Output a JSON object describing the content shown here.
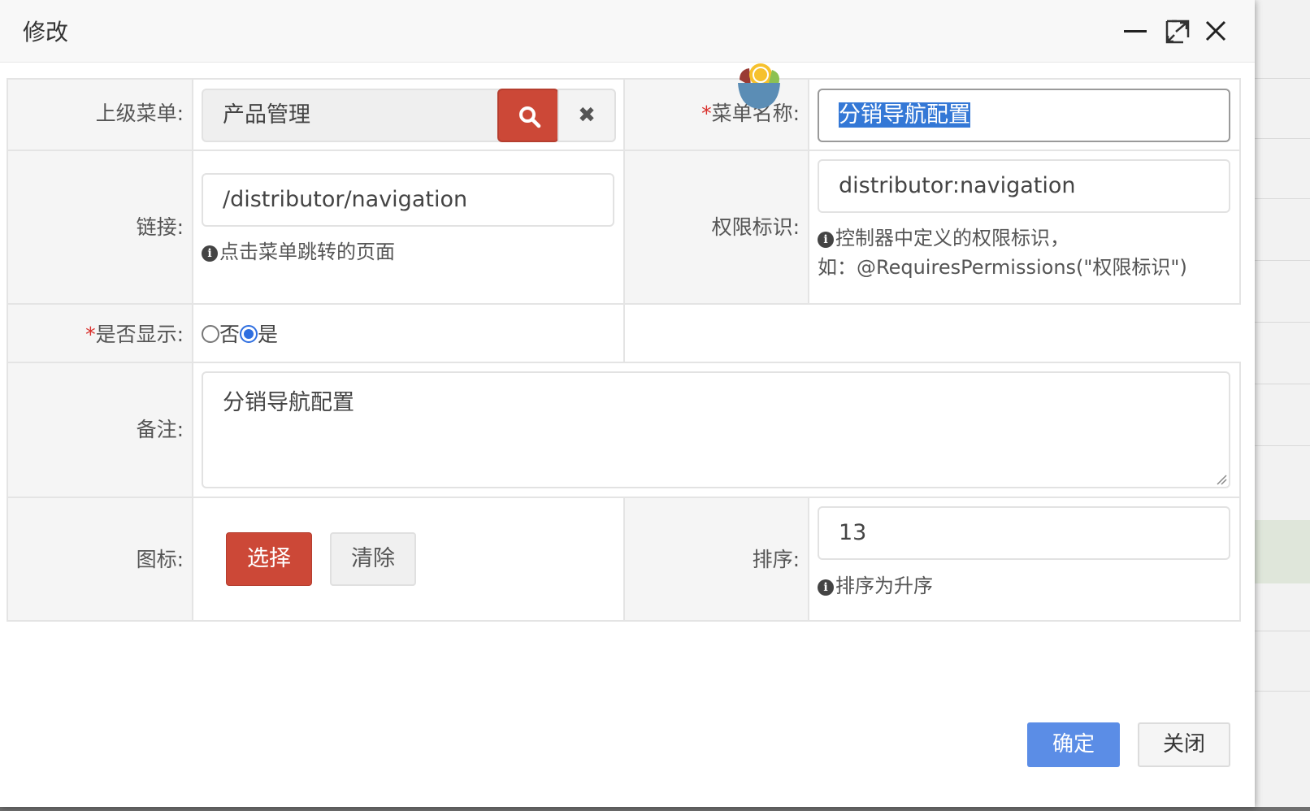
{
  "dialog": {
    "title": "修改",
    "window_controls": [
      "minimize-icon",
      "maximize-icon",
      "close-icon"
    ]
  },
  "form": {
    "parent_menu": {
      "label": "上级菜单:",
      "value": "产品管理",
      "clear_symbol": "✖"
    },
    "menu_name": {
      "required_mark": "*",
      "label": "菜单名称:",
      "value": "分销导航配置"
    },
    "link": {
      "label": "链接:",
      "value": "/distributor/navigation",
      "help": "点击菜单跳转的页面"
    },
    "permission": {
      "label": "权限标识:",
      "value": "distributor:navigation",
      "help_line1": "控制器中定义的权限标识，",
      "help_line2": "如：@RequiresPermissions(\"权限标识\")"
    },
    "visible": {
      "required_mark": "*",
      "label": "是否显示:",
      "options": [
        "否",
        "是"
      ],
      "selected": "是"
    },
    "remarks": {
      "label": "备注:",
      "value": "分销导航配置"
    },
    "icon": {
      "label": "图标:",
      "select_label": "选择",
      "clear_label": "清除"
    },
    "sort": {
      "label": "排序:",
      "value": "13",
      "help": "排序为升序"
    }
  },
  "footer": {
    "ok_label": "确定",
    "close_label": "关闭"
  },
  "colors": {
    "accent_red": "#cc4837",
    "primary_blue": "#5b8de6",
    "required": "#d9302c"
  },
  "info_glyph": "i"
}
